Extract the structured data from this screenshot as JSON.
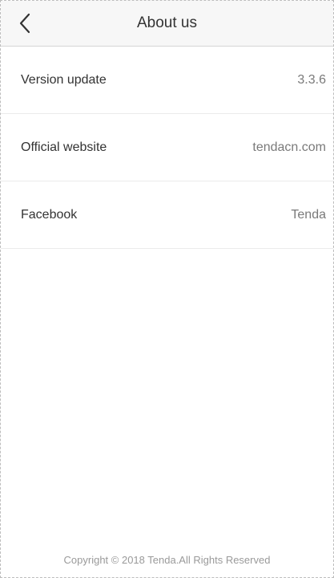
{
  "header": {
    "title": "About us",
    "back_icon": "chevron-left-icon"
  },
  "items": [
    {
      "label": "Version update",
      "value": "3.3.6"
    },
    {
      "label": "Official website",
      "value": "tendacn.com"
    },
    {
      "label": "Facebook",
      "value": "Tenda"
    }
  ],
  "footer": {
    "copyright": "Copyright © 2018 Tenda.All Rights Reserved"
  },
  "colors": {
    "header_bg": "#f7f7f7",
    "text_primary": "#333333",
    "text_secondary": "#7a7a7a",
    "divider": "#ebebeb",
    "footer_text": "#9a9a9a"
  }
}
